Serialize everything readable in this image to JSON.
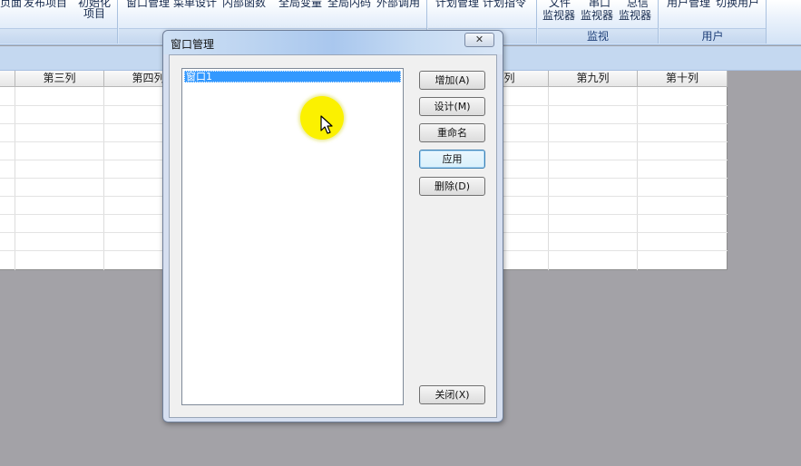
{
  "ribbon": {
    "buttons": [
      "页面",
      "发布项目",
      "初始化",
      "项目",
      "窗口管理",
      "菜单设计",
      "内部函数",
      "全局变量",
      "全局内码",
      "外部调用",
      "计划管理",
      "计划指令",
      "文件",
      "串口",
      "总信",
      "监视器",
      "监视器",
      "监视器",
      "用户管理",
      "切换用户"
    ],
    "group_captions": [
      "监视",
      "用户"
    ]
  },
  "grid": {
    "columns": [
      "第三列",
      "第四列",
      "八列",
      "第九列",
      "第十列"
    ]
  },
  "dialog": {
    "title": "窗口管理",
    "close_label": "✕",
    "list_items": [
      "窗口1"
    ],
    "buttons": {
      "add": "增加(A)",
      "design": "设计(M)",
      "rename": "重命名",
      "apply": "应用",
      "delete": "删除(D)",
      "close": "关闭(X)"
    }
  },
  "colors": {
    "selection": "#3399ff",
    "cursor_highlight": "#fbf100"
  }
}
